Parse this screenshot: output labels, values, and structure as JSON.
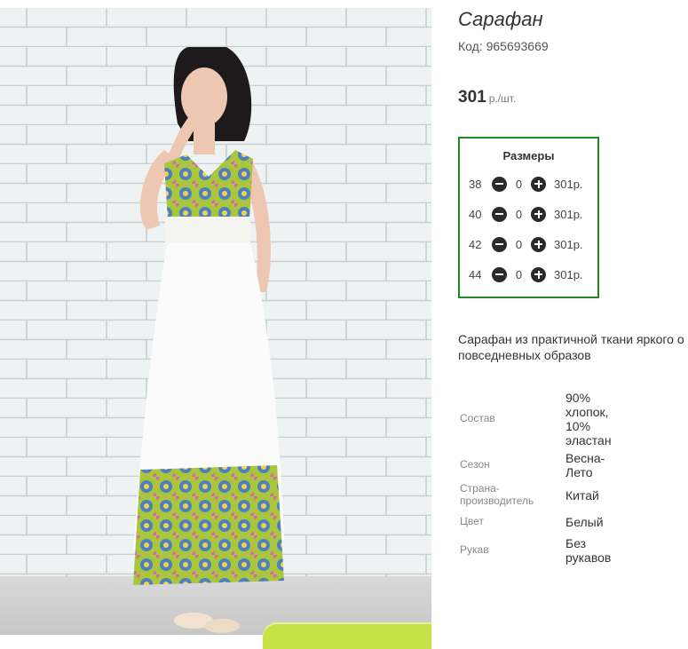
{
  "product": {
    "title": "Сарафан",
    "code_label": "Код: 965693669",
    "price": "301",
    "price_unit": "р./шт."
  },
  "sizes": {
    "title": "Размеры",
    "rows": [
      {
        "size": "38",
        "qty": "0",
        "price": "301р."
      },
      {
        "size": "40",
        "qty": "0",
        "price": "301р."
      },
      {
        "size": "42",
        "qty": "0",
        "price": "301р."
      },
      {
        "size": "44",
        "qty": "0",
        "price": "301р."
      }
    ]
  },
  "description": {
    "line1": "Сарафан из практичной ткани яркого о",
    "line2": "повседневных образов"
  },
  "specs": [
    {
      "label": "Состав",
      "value_lines": [
        "90%",
        "хлопок,",
        "10%",
        "эластан"
      ]
    },
    {
      "label": "Сезон",
      "value_lines": [
        "Весна-",
        "Лето"
      ]
    },
    {
      "label_lines": [
        "Страна-",
        "производитель"
      ],
      "value_lines": [
        "Китай"
      ]
    },
    {
      "label": "Цвет",
      "value_lines": [
        "Белый"
      ]
    },
    {
      "label": "Рукав",
      "value_lines": [
        "Без",
        "рукавов"
      ]
    }
  ],
  "icons": {
    "minus": "minus-circle-icon",
    "plus": "plus-circle-icon"
  },
  "colors": {
    "sizes_border": "#1f8a24",
    "cart_button": "#c6e246"
  }
}
